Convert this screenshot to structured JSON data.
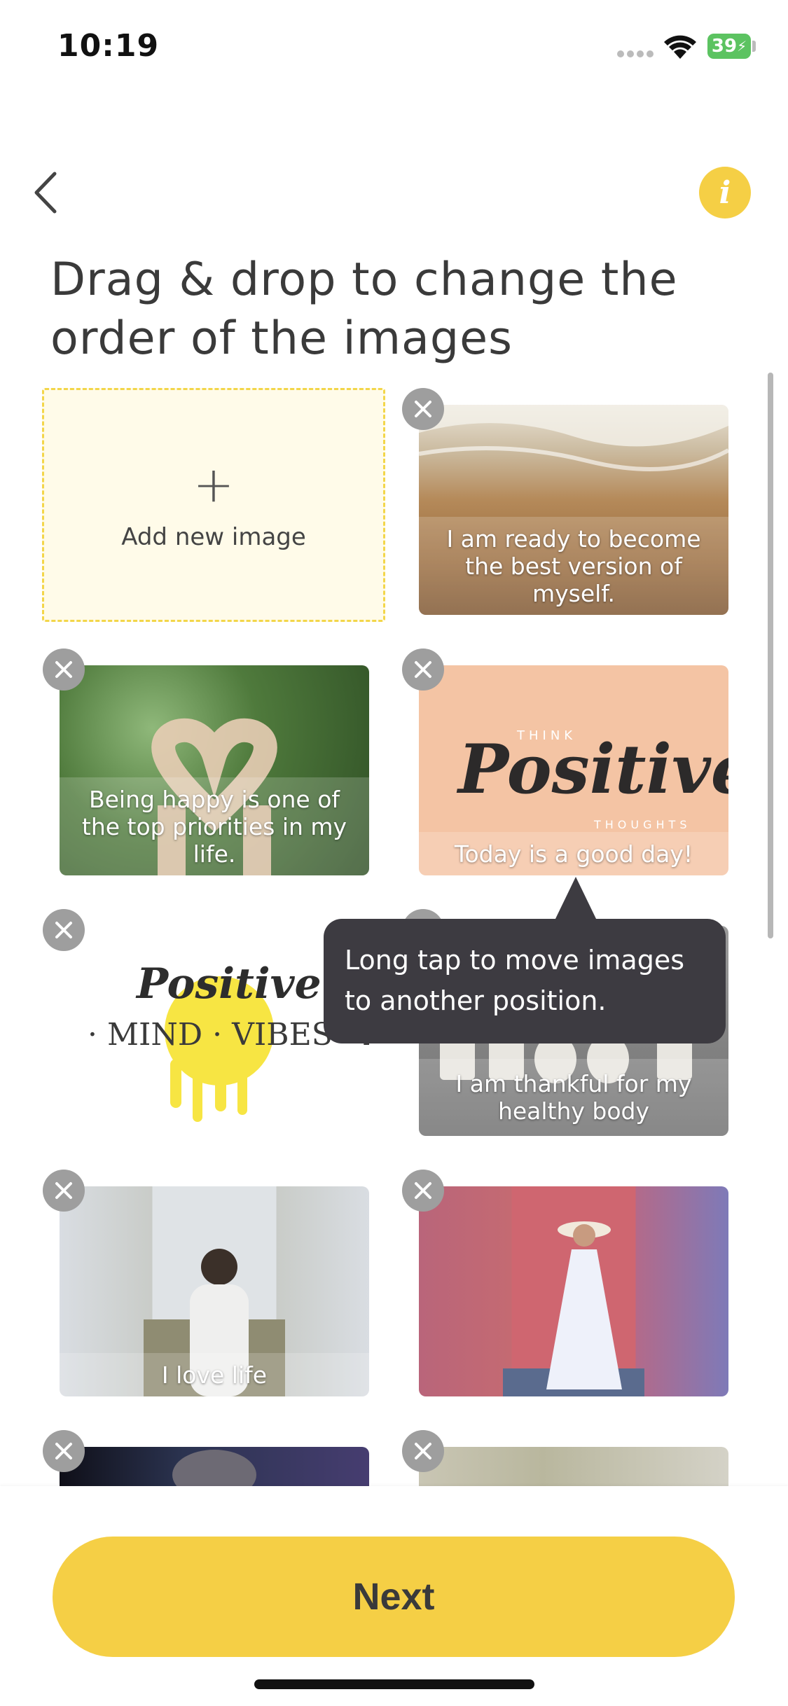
{
  "status_bar": {
    "time": "10:19",
    "battery": "39"
  },
  "header": {
    "back_icon": "chevron-left-icon",
    "info_icon": "info-icon",
    "info_label": "i"
  },
  "title": "Drag & drop to change the order of the images",
  "add_tile": {
    "plus": "+",
    "label": "Add new image"
  },
  "images": [
    {
      "caption": "I am ready to become the best version of myself."
    },
    {
      "caption": "Being happy is one of the top priorities in my life."
    },
    {
      "caption": "Today is a good day!",
      "poster_small_top": "THINK",
      "poster_word": "Positive",
      "poster_small_bottom": "THOUGHTS"
    },
    {
      "caption": "",
      "logo_word": "Positive",
      "logo_line": "· MIND · VIBES · LIFE"
    },
    {
      "caption": "I am thankful for my healthy body"
    },
    {
      "caption": "I love life"
    },
    {
      "caption": ""
    },
    {
      "caption": ""
    },
    {
      "caption": ""
    }
  ],
  "tooltip": "Long tap to move images to another position.",
  "next_button": "Next",
  "colors": {
    "accent": "#f5cf45",
    "tooltip_bg": "#3d3b41",
    "remove_bg": "#9e9e9e"
  }
}
